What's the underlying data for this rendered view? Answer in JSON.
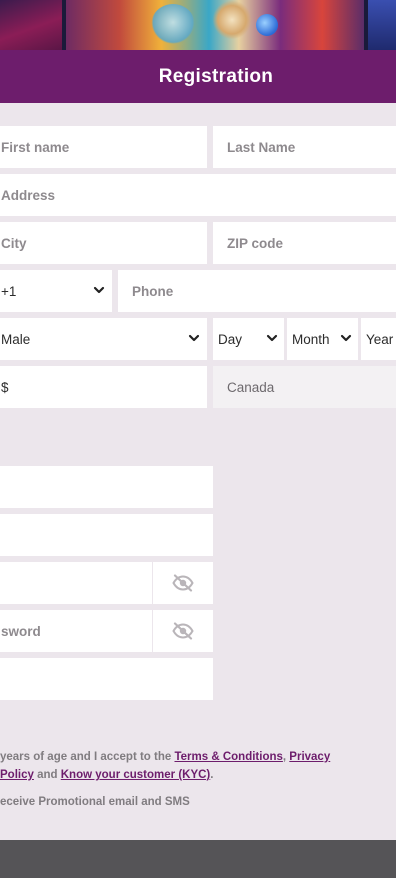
{
  "header": {
    "title": "Registration"
  },
  "form": {
    "first_name": {
      "placeholder": "First name"
    },
    "last_name": {
      "placeholder": "Last Name"
    },
    "address": {
      "placeholder": "Address"
    },
    "city": {
      "placeholder": "City"
    },
    "zip": {
      "placeholder": "ZIP code"
    },
    "country_code": {
      "value": "+1"
    },
    "phone": {
      "placeholder": "Phone"
    },
    "gender": {
      "value": "Male"
    },
    "birth_day": {
      "value": "Day"
    },
    "birth_month": {
      "value": "Month"
    },
    "birth_year": {
      "value": "Year"
    },
    "currency": {
      "value": "$"
    },
    "country": {
      "value": "Canada"
    },
    "confirm_password": {
      "label": "sword"
    }
  },
  "terms": {
    "age_text": "years of age and I accept to the",
    "terms_link": "Terms & Conditions",
    "comma": ",",
    "privacy_link_1": "Privacy",
    "privacy_link_2": "Policy",
    "and_text": "and",
    "kyc_link": "Know your customer (KYC)",
    "period": ".",
    "promo_text": "eceive Promotional email and SMS"
  },
  "icons": {
    "chevron": "chevron-down-icon",
    "eye": "eye-slash-icon"
  },
  "colors": {
    "brand": "#6d1d6c",
    "page_bg": "#ece6ec",
    "footer": "#555457"
  }
}
